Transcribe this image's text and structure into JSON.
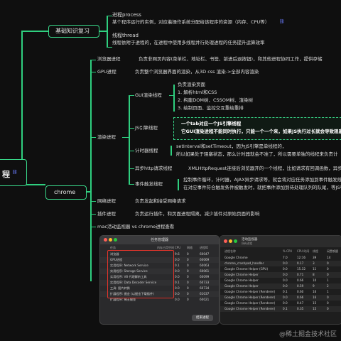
{
  "root": {
    "label": "程",
    "link_icon": "link-icon"
  },
  "basics": {
    "label": "基础知识复习",
    "process_title": "进程process",
    "process_desc": "某个程序运行的实例，对应着操作系统分配给该程序的资源（内存、CPU等）",
    "thread_title": "线程thread",
    "thread_desc": "线程依附于进程的，在进程中使用多线程并行处理进程的任务提升运算效率"
  },
  "chrome": {
    "label": "chrome",
    "browser": {
      "label": "浏览器进程",
      "desc": "负责非网页内容(菜单栏、地址栏、书签、前进后退按钮)，和其他进程协同工作，提供存储"
    },
    "gpu": {
      "label": "GPU进程",
      "desc": "负责整个浏览器界面的渲染，从3D css 渲染->全部内容渲染"
    },
    "render": {
      "label": "渲染进程",
      "gui": {
        "label": "GUI渲染线程",
        "items": [
          "负责渲染页面",
          "1. 解析html和CSS",
          "2. 构建DOM树、CSSOM树、渲染树",
          "3. 绘制页面、监控交互重绘重排"
        ]
      },
      "js": {
        "label": "JS引擎线程",
        "line1": "一个tab对应一个JS引擎线程",
        "line2": "它GUI渲染进程不能同时执行，只能一个一个来，如果JS执行过长就会导致阻塞"
      },
      "timer": {
        "label": "计时器线程",
        "line1": "setInterval和setTimeout，因为JS引擎是单线程的，",
        "line2": "所以如果处于阻塞状态，那么计时器就会不准了，所以需要单独的线程来负责计"
      },
      "http": {
        "label": "异步http请求线程",
        "desc": "XMLHttpRequest连接后浏览器开的一个线程，比如请求有回调函数，异步"
      },
      "event": {
        "label": "事件触发线程",
        "line1": "控制事件循环，计时器，AJAX异步请求等，就会将对应任务添加到事件触发线",
        "line2": "在对应事件符合触发条件被触发时，就把事件添加到待处理队列的队尾，等JS引"
      }
    },
    "network": {
      "label": "网络进程",
      "desc": "负责发起和接受网络请求"
    },
    "plugin": {
      "label": "插件进程",
      "desc": "负责运行插件，和页面进程隔离，减少插件对原始页面的影响"
    }
  },
  "compare_label": "mac活动监视器 vs chrome进程查看",
  "task_manager": {
    "title": "任务管理器",
    "headers": [
      "任务",
      "内存占用空间",
      "CPU",
      "网络",
      "进程ID"
    ],
    "rows": [
      [
        "浏览器",
        "",
        "9.6",
        "0",
        "60047"
      ],
      [
        "GPU进程",
        "",
        "0.0",
        "0",
        "60069"
      ],
      [
        "实用程序: Network Service",
        "",
        "0.1",
        "0",
        "60063"
      ],
      [
        "实用程序: Storage Service",
        "",
        "0.0",
        "0",
        "60061"
      ],
      [
        "实用程序: V8 代理解析工具",
        "",
        "0.0",
        "0",
        "60099"
      ],
      [
        "实用程序: Data Decoder Service",
        "",
        "0.1",
        "0",
        "60733"
      ],
      [
        "工具: 图片转换",
        "",
        "0.0",
        "0",
        "60734"
      ],
      [
        "扩展程序: 掘金 (以掘金下载插件)",
        "",
        "0.0",
        "0",
        "61037"
      ],
      [
        "扩展程序: 稀土掘金",
        "",
        "0.0",
        "0",
        "60021"
      ]
    ],
    "end_button": "结束进程"
  },
  "activity_monitor": {
    "title": "活动监视器",
    "subtitle": "所有进程",
    "headers": [
      "进程名称",
      "% CPU",
      "CPU 时间",
      "线程",
      "闲置唤醒"
    ],
    "rows": [
      [
        "Google Chrome",
        "7.0",
        "12:16",
        "39",
        "14"
      ],
      [
        "chrome_crashpad_handler",
        "0.0",
        "0.17",
        "3",
        "0"
      ],
      [
        "Google Chrome Helper (GPU)",
        "0.0",
        "15.32",
        "11",
        "0"
      ],
      [
        "Google Chrome Helper",
        "0.0",
        "0.71",
        "8",
        "0"
      ],
      [
        "Google Chrome Helper",
        "0.0",
        "0.66",
        "10",
        "1"
      ],
      [
        "Google Chrome Helper",
        "0.0",
        "0.59",
        "9",
        "2"
      ],
      [
        "Google Chrome Helper (Renderer)",
        "0.1",
        "0.60",
        "16",
        "1"
      ],
      [
        "Google Chrome Helper (Renderer)",
        "0.0",
        "0.66",
        "16",
        "0"
      ],
      [
        "Google Chrome Helper (Renderer)",
        "0.0",
        "0.47",
        "15",
        "0"
      ],
      [
        "Google Chrome Helper (Renderer)",
        "0.1",
        "0.35",
        "15",
        "0"
      ]
    ]
  },
  "watermark": "@稀土掘金技术社区",
  "colors": {
    "accent": "#2fcf7f",
    "highlight": "#39d98a",
    "link": "#6a7cff",
    "bg": "#0f0f0f"
  }
}
